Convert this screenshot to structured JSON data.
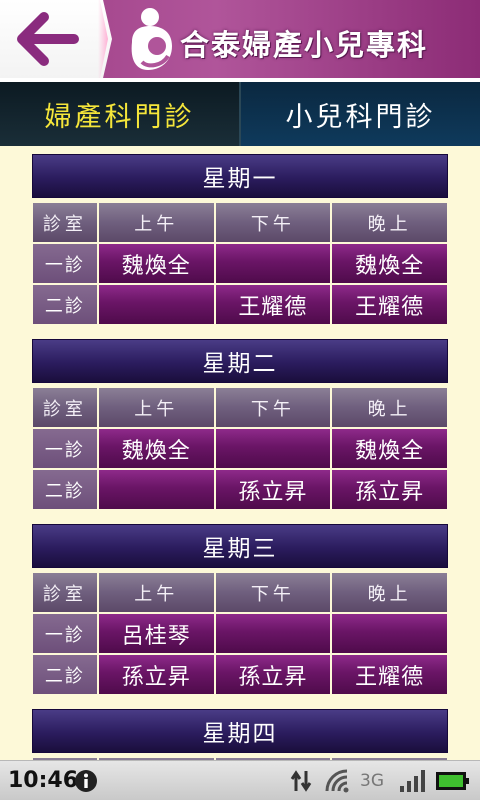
{
  "header": {
    "title": "合泰婦產小兒專科",
    "back_icon": "back-arrow-icon",
    "logo_icon": "mother-child-logo-icon"
  },
  "tabs": [
    {
      "label": "婦產科門診",
      "selected": true
    },
    {
      "label": "小兒科門診",
      "selected": false
    }
  ],
  "columns": [
    "診室",
    "上午",
    "下午",
    "晚上"
  ],
  "schedule": [
    {
      "day": "星期一",
      "rows": [
        {
          "room": "一診",
          "morning": "魏煥全",
          "afternoon": "",
          "evening": "魏煥全"
        },
        {
          "room": "二診",
          "morning": "",
          "afternoon": "王耀德",
          "evening": "王耀德"
        }
      ]
    },
    {
      "day": "星期二",
      "rows": [
        {
          "room": "一診",
          "morning": "魏煥全",
          "afternoon": "",
          "evening": "魏煥全"
        },
        {
          "room": "二診",
          "morning": "",
          "afternoon": "孫立昇",
          "evening": "孫立昇"
        }
      ]
    },
    {
      "day": "星期三",
      "rows": [
        {
          "room": "一診",
          "morning": "呂桂琴",
          "afternoon": "",
          "evening": ""
        },
        {
          "room": "二診",
          "morning": "孫立昇",
          "afternoon": "孫立昇",
          "evening": "王耀德"
        }
      ]
    },
    {
      "day": "星期四",
      "rows": []
    }
  ],
  "status_bar": {
    "time": "10:46",
    "network_label": "3G",
    "icons": [
      "info-icon",
      "data-transfer-icon",
      "wifi-icon",
      "signal-icon",
      "battery-icon"
    ]
  },
  "colors": {
    "header_purple": "#9e3f86",
    "selected_tab_text": "#f5e63a",
    "day_header": "#2b1c5e",
    "doctor_cell": "#6a1566",
    "page_background": "#fdf9d8"
  }
}
